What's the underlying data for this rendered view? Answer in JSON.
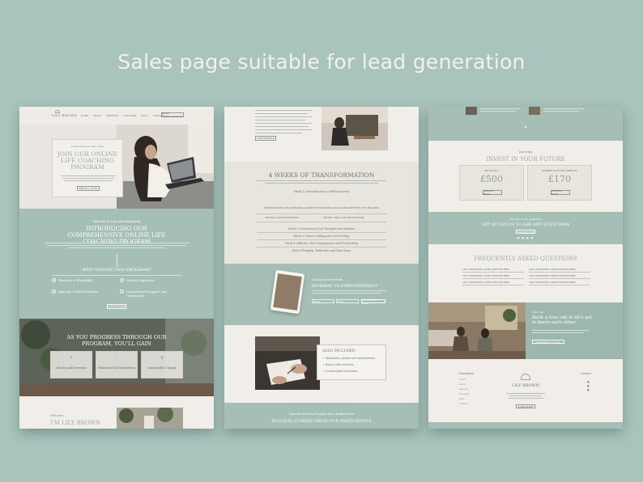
{
  "headline": "Sales page suitable for lead generation",
  "panel1": {
    "brand": "LILY BROWN",
    "nav": [
      "HOME",
      "ABOUT",
      "SERVICES",
      "COACHING",
      "BLOG",
      "CONTACT"
    ],
    "nav_button": "BOOK CONSULTATION",
    "hero_kicker": "Transform Your Life Today",
    "hero_title": "JOIN OUR ONLINE LIFE COACHING PROGRAM",
    "hero_button": "ENROLL NOW",
    "intro_kicker": "Welcome to Your New Beginning",
    "intro_title": "INTRODUCING OUR COMPREHENSIVE ONLINE LIFE COACHING PROGRAM",
    "why_title": "WHY CHOOSE THIS PROGRAM?",
    "features": [
      "Discover & Flexibility",
      "Holistic Approach",
      "Expertly Crafted Modules",
      "Personalized Support and Community"
    ],
    "why_button": "LEARN MORE",
    "gain_title": "AS YOU PROGRESS THROUGH OUR PROGRAM, YOU'LL GAIN",
    "gains": [
      "Clarity and Direction",
      "Enhanced Self-Awareness",
      "Sustainable Change"
    ],
    "about_kicker": "Welcome,",
    "about_title": "I'M LILY BROWN"
  },
  "panel2": {
    "top_button": "LEARN MORE",
    "weeks_title": "4 WEEKS OF TRANSFORMATION",
    "week1": "Week 1: Introduction to Self-Discovery",
    "understand": "UNDERSTANDING YOUR PERSONAL JOURNEY: ESTABLISHING GOALS AND IDENTIFYING THE PROGRAM",
    "pills": [
      "SETTING YOUR INTENTIONS",
      "DEFINE YOUR CORE MOTIVATIONS"
    ],
    "weeks": [
      "Week 2: Overcoming Your Thoughts and Mindset",
      "Week 3: Vision Crafting and Goal Setting",
      "Week 4: Effective Time Management and Productivity",
      "End of Program: Reflection and Next Steps"
    ],
    "free_kicker": "Grab your free ebook",
    "free_title": "PATHWAY TO EMPOWERMENT",
    "free_fields": [
      "Name",
      "Email"
    ],
    "free_button": "DOWNLOAD NOW",
    "also_title": "ALSO INCLUDED",
    "also_items": [
      "Workbooks, guides and spreadsheets",
      "Bonus video tutorials",
      "Customizable templates"
    ],
    "success_kicker": "Discover How Our Program Has Changed Lives",
    "success_title": "SUCCESS STORIES FROM OUR PARTICIPANTS"
  },
  "panel3": {
    "invest_kicker": "Join today",
    "invest_title": "INVEST IN YOUR FUTURE",
    "plans": [
      {
        "label": "PAY IN FULL",
        "price": "£500",
        "button": "ENROLL NOW"
      },
      {
        "label": "PAYMENT PLAN FOR 3 MONTHS",
        "price": "£170",
        "button": "ENROLL NOW"
      }
    ],
    "contact_kicker": "Still have some questions?",
    "contact_title": "GET IN TOUCH TO ASK ANY QUESTIONS",
    "contact_button": "CONTACT ME",
    "faq_title": "FREQUENTLY ASKED QUESTIONS",
    "faq_items": [
      "ADD A FREQUENTLY ASKED QUESTION HERE",
      "ADD A FREQUENTLY ASKED QUESTION HERE",
      "ADD A FREQUENTLY ASKED QUESTION HERE",
      "ADD A FREQUENTLY ASKED QUESTION HERE",
      "ADD A FREQUENTLY ASKED QUESTION HERE",
      "ADD A FREQUENTLY ASKED QUESTION HERE"
    ],
    "call_kicker": "Let's chat",
    "call_title": "Book a free call & let's get to know each other",
    "call_button": "SCHEDULE A CALL",
    "footer_nav_title": "Navigation",
    "footer_nav": [
      "Home",
      "About",
      "Services",
      "Coaching",
      "Blog",
      "Contact"
    ],
    "footer_brand": "LILY BROWN",
    "footer_button": "SUBSCRIBE",
    "footer_contact_title": "Contact"
  }
}
